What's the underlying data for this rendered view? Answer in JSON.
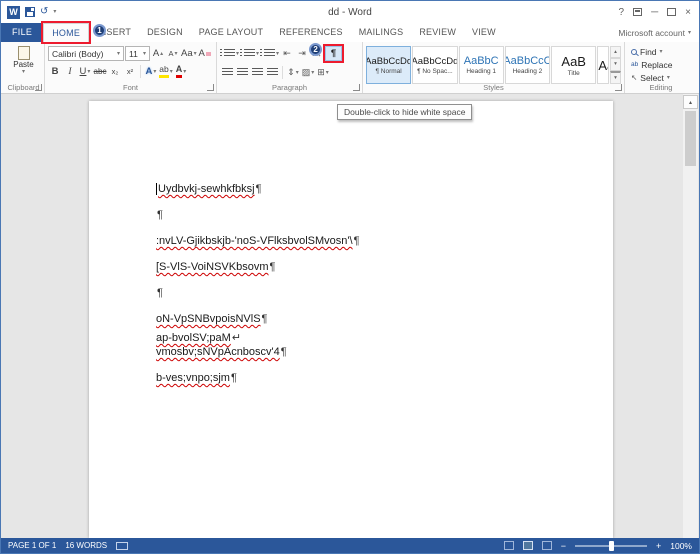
{
  "titlebar": {
    "title": "dd - Word"
  },
  "tabs": {
    "file": "FILE",
    "home": "HOME",
    "insert": "INSERT",
    "design": "DESIGN",
    "page_layout": "PAGE LAYOUT",
    "references": "REFERENCES",
    "mailings": "MAILINGS",
    "review": "REVIEW",
    "view": "VIEW",
    "account": "Microsoft account"
  },
  "ribbon": {
    "clipboard": {
      "label": "Clipboard",
      "paste": "Paste"
    },
    "font": {
      "label": "Font",
      "name": "Calibri (Body)",
      "size": "11",
      "grow": "A",
      "shrink": "A",
      "change_case": "Aa",
      "clear": "A",
      "bold": "B",
      "italic": "I",
      "underline": "U",
      "strike": "abc",
      "subscript": "x₂",
      "superscript": "x²",
      "effects": "A",
      "highlight": "ab",
      "font_color": "A"
    },
    "paragraph": {
      "label": "Paragraph",
      "sort": "A↓"
    },
    "styles": {
      "label": "Styles",
      "items": [
        {
          "sample": "AaBbCcDd",
          "name": "¶ Normal"
        },
        {
          "sample": "AaBbCcDd",
          "name": "¶ No Spac..."
        },
        {
          "sample": "AaBbC",
          "name": "Heading 1"
        },
        {
          "sample": "AaBbCcC",
          "name": "Heading 2"
        },
        {
          "sample": "AaB",
          "name": "Title"
        },
        {
          "sample": "AaBl",
          "name": ""
        }
      ]
    },
    "editing": {
      "label": "Editing",
      "find": "Find",
      "replace": "Replace",
      "select": "Select"
    }
  },
  "tooltip": "Double-click to hide white space",
  "annotations": {
    "step1": "1",
    "step2": "2"
  },
  "document": {
    "lines": [
      {
        "text": "Uydbvkj-sewhkfbksj",
        "mark": "¶"
      },
      {
        "text": "",
        "mark": "¶"
      },
      {
        "text": ":nvLV-Gjikbskjb-'noS-VFlksbvolSMvosn'\\",
        "mark": "¶"
      },
      {
        "text": "[S-VlS-VoiNSVKbsovm",
        "mark": "¶"
      },
      {
        "text": "",
        "mark": "¶"
      },
      {
        "text": "oN-VpSNBvpoisNVlS",
        "mark": "¶"
      },
      {
        "text": "ap-bvolSV;paM",
        "mark": "↵"
      },
      {
        "text": "vmosbv;sNVpAcnboscv'4",
        "mark": "¶"
      },
      {
        "text": "b-ves;vnpo;sjm",
        "mark": "¶"
      }
    ]
  },
  "statusbar": {
    "page": "PAGE 1 OF 1",
    "words": "16 WORDS",
    "zoom": "100%"
  },
  "colors": {
    "accent": "#2b579a",
    "annotation_red": "#ed1b2e",
    "badge_blue": "#1f3f77",
    "heading_blue": "#2e74b5"
  }
}
